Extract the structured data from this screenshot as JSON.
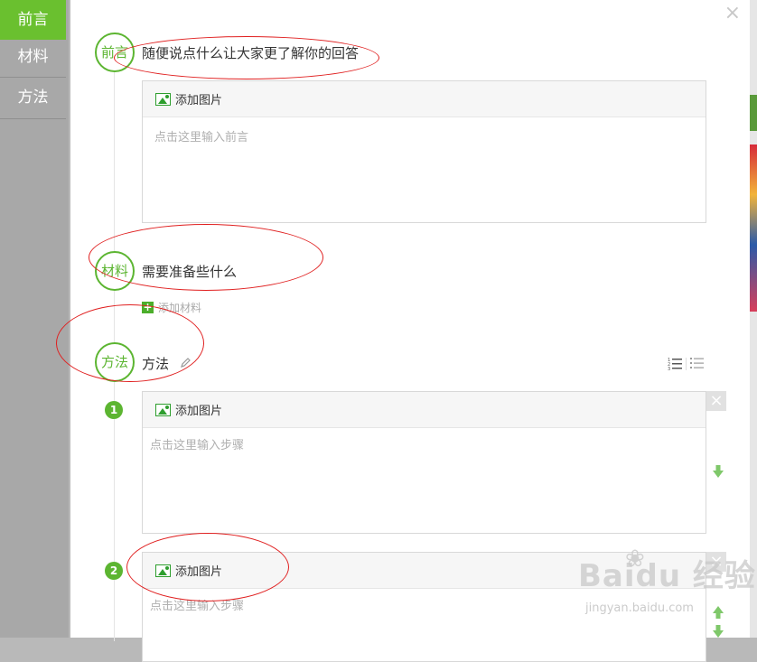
{
  "nav": {
    "items": [
      "前言",
      "材料",
      "方法"
    ],
    "active": 0
  },
  "sections": {
    "intro": {
      "badge": "前言",
      "title": "随便说点什么让大家更了解你的回答",
      "add_image": "添加图片",
      "placeholder": "点击这里输入前言"
    },
    "materials": {
      "badge": "材料",
      "title": "需要准备些什么",
      "add_material": "添加材料"
    },
    "method": {
      "badge": "方法",
      "title": "方法",
      "steps": [
        {
          "num": "1",
          "add_image": "添加图片",
          "placeholder": "点击这里输入步骤"
        },
        {
          "num": "2",
          "add_image": "添加图片",
          "placeholder": "点击这里输入步骤"
        }
      ]
    }
  },
  "close": "×",
  "watermark": {
    "brand": "Baidu 经验",
    "url": "jingyan.baidu.com"
  },
  "colors": {
    "accent": "#5cb531",
    "nav_active": "#6ac02f",
    "annotation": "#e02020"
  }
}
